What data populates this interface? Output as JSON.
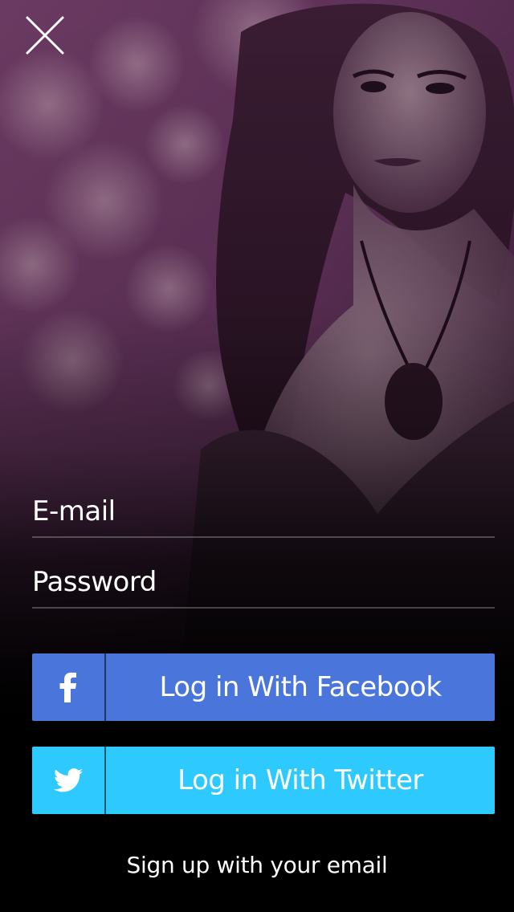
{
  "form": {
    "email_placeholder": "E-mail",
    "email_value": "",
    "password_placeholder": "Password",
    "password_value": ""
  },
  "buttons": {
    "facebook_label": "Log in With Facebook",
    "twitter_label": "Log in With Twitter",
    "signup_label": "Sign up with your email"
  },
  "icons": {
    "close": "close-icon",
    "facebook": "facebook-icon",
    "twitter": "twitter-icon"
  },
  "colors": {
    "facebook": "#4a76dc",
    "twitter": "#2ec9ff",
    "background_tint": "#5a2a4e"
  }
}
